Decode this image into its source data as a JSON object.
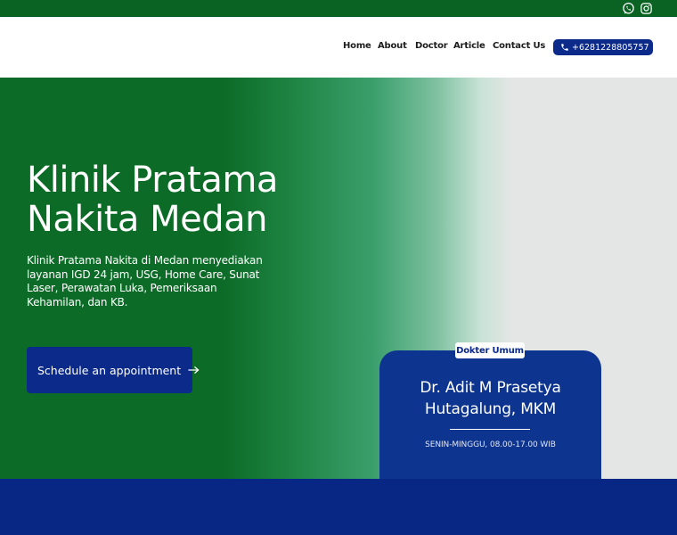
{
  "topbar": {
    "icons": [
      "whatsapp-icon",
      "instagram-icon"
    ],
    "color": "#0a6322"
  },
  "nav": {
    "items": [
      "Home",
      "About",
      "Doctor",
      "Article",
      "Contact Us"
    ],
    "phone": "+6281228805757"
  },
  "hero": {
    "title_line1": "Klinik Pratama",
    "title_line2": "Nakita Medan",
    "description": "Klinik Pratama Nakita di Medan menyediakan layanan IGD 24 jam, USG, Home Care, Sunat Laser, Perawatan Luka, Pemeriksaan Kehamilan, dan KB.",
    "cta_label": "Schedule an appointment"
  },
  "doctor": {
    "badge": "Dokter Umum",
    "name_line1": "Dr. Adit M Prasetya",
    "name_line2": "Hutagalung, MKM",
    "hours": "SENIN-MINGGU, 08.00-17.00 WIB"
  },
  "colors": {
    "green": "#0c6b27",
    "navy": "#0b2a8a",
    "light_gray": "#e4e6e5"
  }
}
